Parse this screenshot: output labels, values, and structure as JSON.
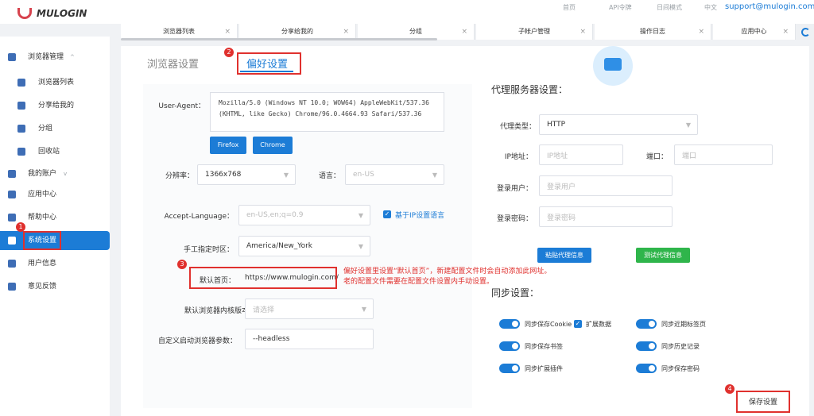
{
  "brand": {
    "name": "MULOGIN"
  },
  "topbar": {
    "links": [
      "首页",
      "API令牌",
      "日间模式",
      "中文"
    ],
    "email": "support@mulogin.com"
  },
  "sidebar": {
    "items": [
      {
        "label": "浏览器管理",
        "expand": "^"
      },
      {
        "label": "浏览器列表"
      },
      {
        "label": "分享给我的"
      },
      {
        "label": "分组"
      },
      {
        "label": "回收站"
      },
      {
        "label": "我的账户",
        "expand": "v"
      },
      {
        "label": "应用中心"
      },
      {
        "label": "帮助中心"
      },
      {
        "label": "系统设置"
      },
      {
        "label": "用户信息"
      },
      {
        "label": "意见反馈"
      }
    ]
  },
  "tabs": [
    {
      "label": "浏览器列表"
    },
    {
      "label": "分享给我的"
    },
    {
      "label": "分组"
    },
    {
      "label": "子帐户管理"
    },
    {
      "label": "操作日志"
    },
    {
      "label": "应用中心"
    }
  ],
  "tab_close": "×",
  "page": {
    "tab_browser": "浏览器设置",
    "tab_prefs": "偏好设置"
  },
  "badges": [
    "1",
    "2",
    "3",
    "4"
  ],
  "form": {
    "user_agent_label": "User-Agent：",
    "user_agent_value": "Mozilla/5.0 (Windows NT 10.0; WOW64) AppleWebKit/537.36 (KHTML, like Gecko) Chrome/96.0.4664.93 Safari/537.36",
    "ua_firefox": "Firefox",
    "ua_chrome": "Chrome",
    "resolution_label": "分辨率：",
    "resolution_value": "1366x768",
    "language_label": "语言：",
    "language_value": "en-US",
    "accept_lang_label": "Accept-Language：",
    "accept_lang_value": "en-US,en;q=0.9",
    "ip_lang_label": "基于IP设置语言",
    "timezone_label": "手工指定时区：",
    "timezone_value": "America/New_York",
    "homepage_label": "默认首页：",
    "homepage_value": "https://www.mulogin.com/",
    "kernel_label": "默认浏览器内核版本：",
    "kernel_placeholder": "请选择",
    "params_label": "自定义启动浏览器参数：",
    "params_value": "--headless"
  },
  "annotation": {
    "line1": "偏好设置里设置“默认首页”，新建配置文件时会自动添加此网址。",
    "line2": "老的配置文件需要在配置文件设置内手动设置。"
  },
  "proxy": {
    "title": "代理服务器设置：",
    "type_label": "代理类型：",
    "type_value": "HTTP",
    "ip_label": "IP地址：",
    "ip_placeholder": "IP地址",
    "port_label": "端口：",
    "port_placeholder": "端口",
    "user_label": "登录用户：",
    "user_placeholder": "登录用户",
    "pass_label": "登录密码：",
    "pass_placeholder": "登录密码",
    "paste_btn": "粘贴代理信息",
    "test_btn": "测试代理信息"
  },
  "sync": {
    "title": "同步设置：",
    "items": [
      {
        "label": "同步保存Cookie",
        "on": true
      },
      {
        "label": "扩展数据",
        "checked": true
      },
      {
        "label": "同步近期标签页",
        "on": true
      },
      {
        "label": "同步保存书签",
        "on": true
      },
      {
        "label": "同步历史记录",
        "on": true
      },
      {
        "label": "同步扩展插件",
        "on": true
      },
      {
        "label": "同步保存密码",
        "on": true
      }
    ]
  },
  "save_btn": "保存设置",
  "colors": {
    "accent": "#1c7cd6",
    "annotation": "#e0312e",
    "green": "#2fb54b"
  }
}
